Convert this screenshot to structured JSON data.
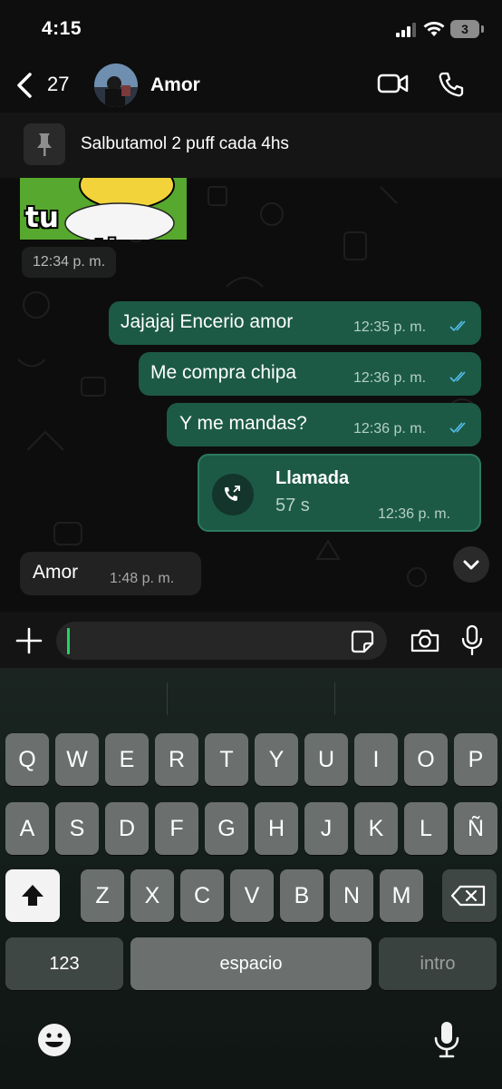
{
  "status_bar": {
    "time": "4:15",
    "battery": "3"
  },
  "header": {
    "back_count": "27",
    "contact_name": "Amor"
  },
  "pinned": {
    "text": "Salbutamol 2 puff cada 4hs"
  },
  "messages": [
    {
      "type": "sticker",
      "sticker_text": "tu mentira",
      "time": "12:34 p. m."
    },
    {
      "type": "outgoing",
      "text": "Jajajaj Encerio amor",
      "time": "12:35 p. m."
    },
    {
      "type": "outgoing",
      "text": "Me compra chipa",
      "time": "12:36 p. m."
    },
    {
      "type": "outgoing",
      "text": "Y me mandas?",
      "time": "12:36 p. m."
    },
    {
      "type": "call",
      "title": "Llamada",
      "duration": "57 s",
      "time": "12:36 p. m."
    },
    {
      "type": "incoming",
      "text": "Amor",
      "time": "1:48 p. m."
    }
  ],
  "keyboard": {
    "rows": [
      [
        "Q",
        "W",
        "E",
        "R",
        "T",
        "Y",
        "U",
        "I",
        "O",
        "P"
      ],
      [
        "A",
        "S",
        "D",
        "F",
        "G",
        "H",
        "J",
        "K",
        "L",
        "Ñ"
      ],
      [
        "Z",
        "X",
        "C",
        "V",
        "B",
        "N",
        "M"
      ]
    ],
    "numbers_label": "123",
    "space_label": "espacio",
    "return_label": "intro"
  },
  "colors": {
    "outgoing_bubble": "#1c5a45",
    "incoming_bubble": "#222222",
    "accent": "#25d366",
    "read_ticks": "#53bdeb"
  }
}
